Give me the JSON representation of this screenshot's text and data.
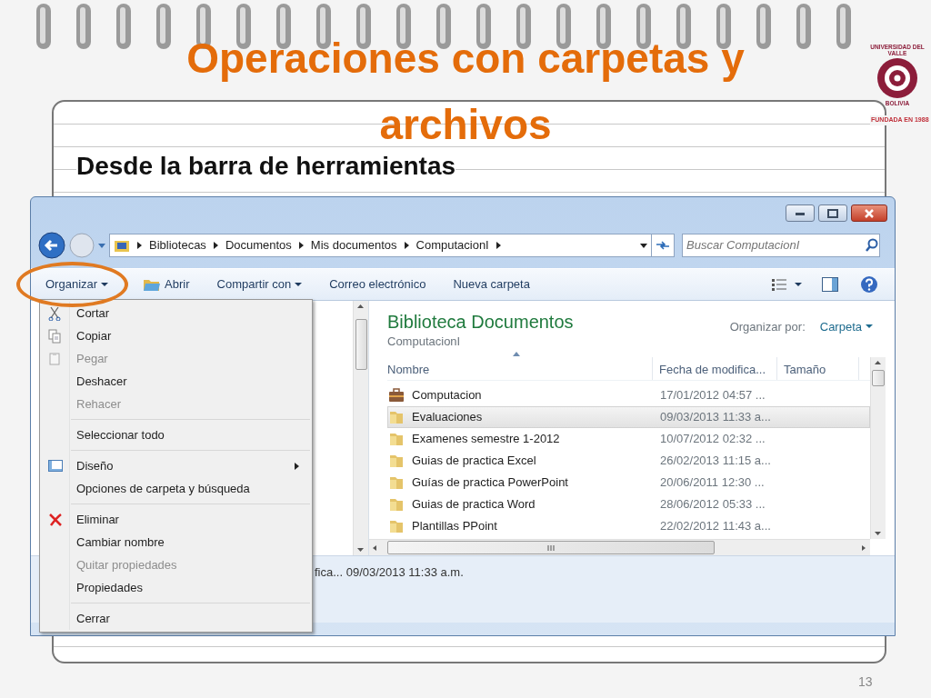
{
  "slide": {
    "title_lines": [
      "Operaciones con carpetas y",
      "archivos"
    ],
    "subtitle": "Desde la barra de herramientas",
    "logo": {
      "ring_top": "UNIVERSIDAD DEL VALLE",
      "ring_bottom": "BOLIVIA",
      "caption": "FUNDADA EN 1988"
    },
    "page_number": "13"
  },
  "window": {
    "breadcrumb": [
      "Bibliotecas",
      "Documentos",
      "Mis documentos",
      "ComputacionI"
    ],
    "search": {
      "placeholder": "Buscar ComputacionI"
    },
    "toolbar": [
      {
        "label": "Organizar",
        "kind": "menu",
        "circled": true
      },
      {
        "label": "Abrir",
        "kind": "open",
        "circled": false
      },
      {
        "label": "Compartir con",
        "kind": "menu",
        "circled": false
      },
      {
        "label": "Correo electrónico",
        "kind": "plain",
        "circled": false
      },
      {
        "label": "Nueva carpeta",
        "kind": "plain",
        "circled": false
      }
    ],
    "library": {
      "title": "Biblioteca Documentos",
      "subtitle": "ComputacionI",
      "arrange_label": "Organizar por:",
      "arrange_value": "Carpeta"
    },
    "columns": [
      "Nombre",
      "Fecha de modifica...",
      "Tamaño"
    ],
    "files": [
      {
        "name": "Computacion",
        "date": "17/01/2012 04:57 ...",
        "kind": "briefcase",
        "selected": false
      },
      {
        "name": "Evaluaciones",
        "date": "09/03/2013 11:33 a...",
        "kind": "folder",
        "selected": true
      },
      {
        "name": "Examenes semestre 1-2012",
        "date": "10/07/2012 02:32 ...",
        "kind": "folder",
        "selected": false
      },
      {
        "name": "Guias de practica Excel",
        "date": "26/02/2013 11:15 a...",
        "kind": "folder",
        "selected": false
      },
      {
        "name": "Guías de practica PowerPoint",
        "date": "20/06/2011 12:30 ...",
        "kind": "folder",
        "selected": false
      },
      {
        "name": "Guias de practica Word",
        "date": "28/06/2012 05:33 ...",
        "kind": "folder",
        "selected": false
      },
      {
        "name": "Plantillas PPoint",
        "date": "22/02/2012 11:43 a...",
        "kind": "folder",
        "selected": false
      }
    ],
    "status": "fica... 09/03/2013 11:33 a.m.",
    "menu": [
      [
        {
          "label": "Cortar",
          "kind": "cut",
          "disabled": false,
          "submenu": false
        },
        {
          "label": "Copiar",
          "kind": "copy",
          "disabled": false,
          "submenu": false
        },
        {
          "label": "Pegar",
          "kind": "paste",
          "disabled": true,
          "submenu": false
        },
        {
          "label": "Deshacer",
          "kind": "plain",
          "disabled": false,
          "submenu": false
        },
        {
          "label": "Rehacer",
          "kind": "plain",
          "disabled": true,
          "submenu": false
        }
      ],
      [
        {
          "label": "Seleccionar todo",
          "kind": "plain",
          "disabled": false,
          "submenu": false
        }
      ],
      [
        {
          "label": "Diseño",
          "kind": "layout",
          "disabled": false,
          "submenu": true
        },
        {
          "label": "Opciones de carpeta y búsqueda",
          "kind": "plain",
          "disabled": false,
          "submenu": false
        }
      ],
      [
        {
          "label": "Eliminar",
          "kind": "delete",
          "disabled": false,
          "submenu": false
        },
        {
          "label": "Cambiar nombre",
          "kind": "plain",
          "disabled": false,
          "submenu": false
        },
        {
          "label": "Quitar propiedades",
          "kind": "plain",
          "disabled": true,
          "submenu": false
        },
        {
          "label": "Propiedades",
          "kind": "plain",
          "disabled": false,
          "submenu": false
        }
      ],
      [
        {
          "label": "Cerrar",
          "kind": "plain",
          "disabled": false,
          "submenu": false
        }
      ]
    ]
  }
}
